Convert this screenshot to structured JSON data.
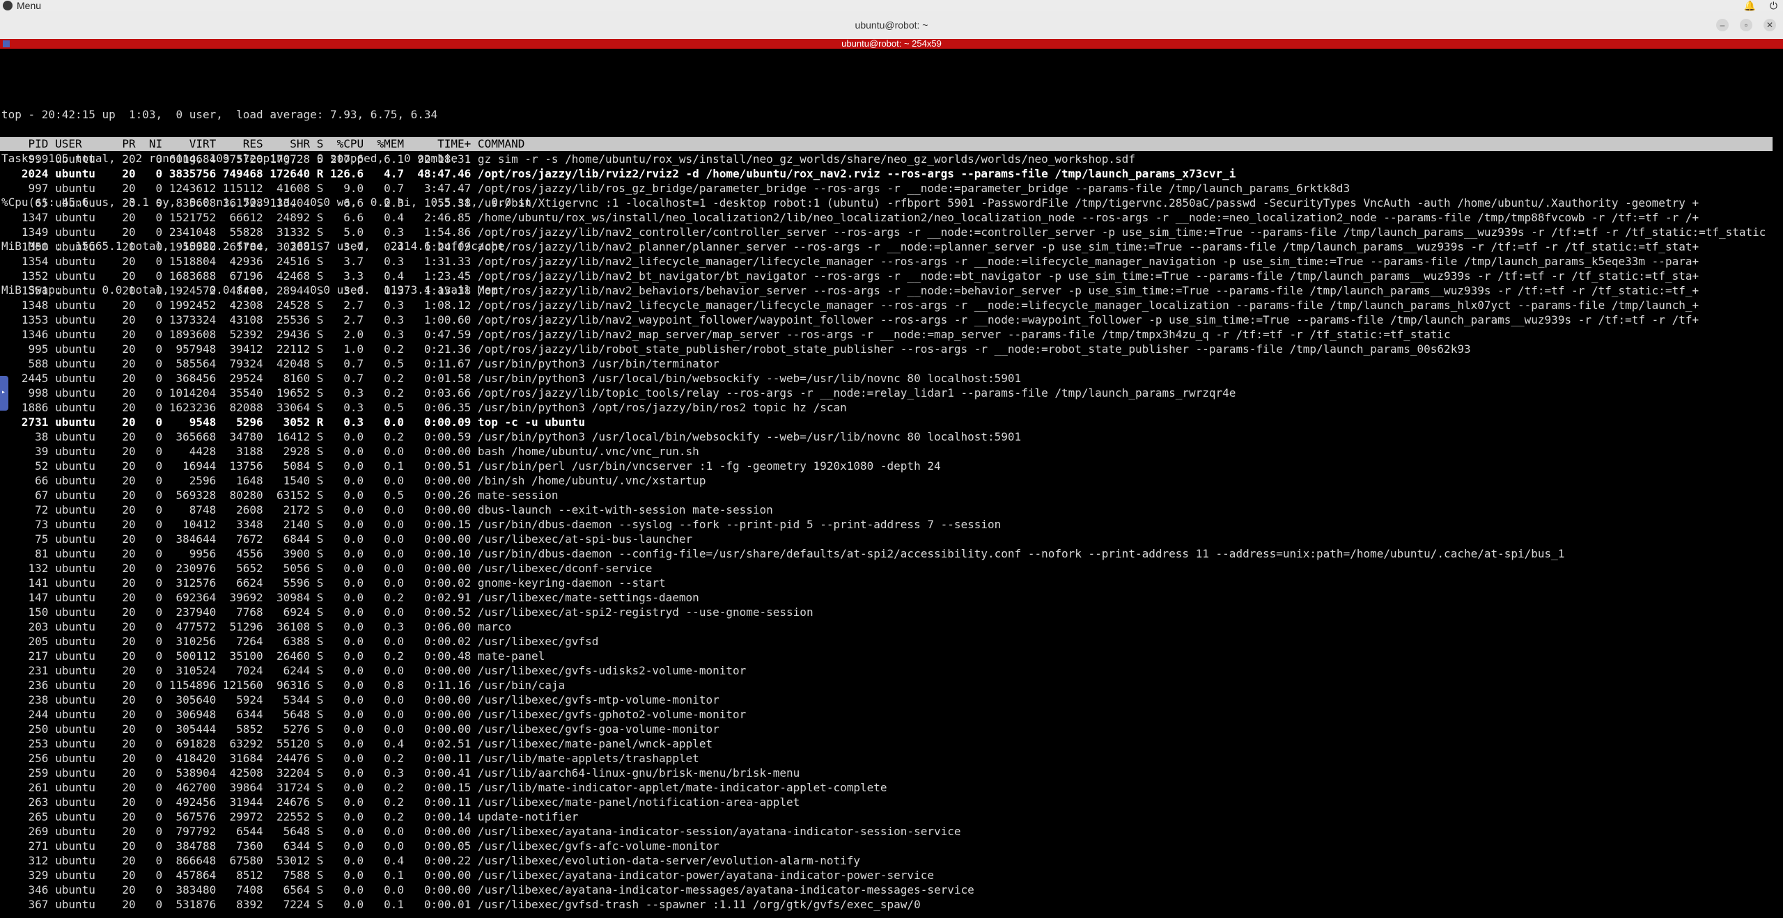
{
  "menubar": {
    "menu_label": "Menu"
  },
  "window": {
    "title": "ubuntu@robot: ~",
    "terminal_title": "ubuntu@robot: ~ 254x59"
  },
  "summary": [
    "top - 20:42:15 up  1:03,  0 user,  load average: 7.93, 6.75, 6.34",
    "Tasks: 105 total,   2 running, 103 sleeping,   0 stopped,   0 zombie",
    "%Cpu(s): 45.6 us,  3.1 sy,  0.0 ni, 50.9 id,  0.0 wa,  0.0 hi,  0.5 si,  0.0 st",
    "MiB Mem :  15665.1 total,  10022.2 free,   3691.7 used,   2314.6 buff/cache",
    "MiB Swap:      0.0 total,      0.0 free,      0.0 used.  11973.4 avail Mem"
  ],
  "header": "    PID USER      PR  NI    VIRT    RES    SHR S  %CPU  %MEM     TIME+ COMMAND",
  "processes": [
    {
      "pid": "999",
      "user": "ubuntu",
      "pr": "20",
      "ni": "0",
      "virt": "6014684",
      "res": "975720",
      "shr": "170728",
      "s": "S",
      "cpu": "207.6",
      "mem": "6.1",
      "time": "92:18.31",
      "cmd": "gz sim -r -s /home/ubuntu/rox_ws/install/neo_gz_worlds/share/neo_gz_worlds/worlds/neo_workshop.sdf"
    },
    {
      "pid": "2024",
      "user": "ubuntu",
      "pr": "20",
      "ni": "0",
      "virt": "3835756",
      "res": "749468",
      "shr": "172640",
      "s": "R",
      "cpu": "126.6",
      "mem": "4.7",
      "time": "48:47.46",
      "cmd": "/opt/ros/jazzy/lib/rviz2/rviz2 -d /home/ubuntu/rox_nav2.rviz --ros-args --params-file /tmp/launch_params_x73cvr_i",
      "bold": true
    },
    {
      "pid": "997",
      "user": "ubuntu",
      "pr": "20",
      "ni": "0",
      "virt": "1243612",
      "res": "115112",
      "shr": "41608",
      "s": "S",
      "cpu": "9.0",
      "mem": "0.7",
      "time": "3:47.47",
      "cmd": "/opt/ros/jazzy/lib/ros_gz_bridge/parameter_bridge --ros-args -r __node:=parameter_bridge --params-file /tmp/launch_params_6rktk8d3"
    },
    {
      "pid": "65",
      "user": "ubuntu",
      "pr": "20",
      "ni": "0",
      "virt": "835608",
      "res": "361728",
      "shr": "133404",
      "s": "S",
      "cpu": "6.6",
      "mem": "2.3",
      "time": "1:55.38",
      "cmd": "/usr/bin/Xtigervnc :1 -localhost=1 -desktop robot:1 (ubuntu) -rfbport 5901 -PasswordFile /tmp/tigervnc.2850aC/passwd -SecurityTypes VncAuth -auth /home/ubuntu/.Xauthority -geometry +"
    },
    {
      "pid": "1347",
      "user": "ubuntu",
      "pr": "20",
      "ni": "0",
      "virt": "1521752",
      "res": "66612",
      "shr": "24892",
      "s": "S",
      "cpu": "6.6",
      "mem": "0.4",
      "time": "2:46.85",
      "cmd": "/home/ubuntu/rox_ws/install/neo_localization2/lib/neo_localization2/neo_localization_node --ros-args -r __node:=neo_localization2_node --params-file /tmp/tmp88fvcowb -r /tf:=tf -r /+"
    },
    {
      "pid": "1349",
      "user": "ubuntu",
      "pr": "20",
      "ni": "0",
      "virt": "2341048",
      "res": "55828",
      "shr": "31332",
      "s": "S",
      "cpu": "5.0",
      "mem": "0.3",
      "time": "1:54.86",
      "cmd": "/opt/ros/jazzy/lib/nav2_controller/controller_server --ros-args -r __node:=controller_server -p use_sim_time:=True --params-file /tmp/launch_params__wuz939s -r /tf:=tf -r /tf_static:=tf_static"
    },
    {
      "pid": "1350",
      "user": "ubuntu",
      "pr": "20",
      "ni": "0",
      "virt": "1955380",
      "res": "65784",
      "shr": "30288",
      "s": "S",
      "cpu": "3.7",
      "mem": "0.4",
      "time": "1:24.09",
      "cmd": "/opt/ros/jazzy/lib/nav2_planner/planner_server --ros-args -r __node:=planner_server -p use_sim_time:=True --params-file /tmp/launch_params__wuz939s -r /tf:=tf -r /tf_static:=tf_stat+"
    },
    {
      "pid": "1354",
      "user": "ubuntu",
      "pr": "20",
      "ni": "0",
      "virt": "1518804",
      "res": "42936",
      "shr": "24516",
      "s": "S",
      "cpu": "3.7",
      "mem": "0.3",
      "time": "1:31.33",
      "cmd": "/opt/ros/jazzy/lib/nav2_lifecycle_manager/lifecycle_manager --ros-args -r __node:=lifecycle_manager_navigation -p use_sim_time:=True --params-file /tmp/launch_params_k5eqe33m --para+"
    },
    {
      "pid": "1352",
      "user": "ubuntu",
      "pr": "20",
      "ni": "0",
      "virt": "1683688",
      "res": "67196",
      "shr": "42468",
      "s": "S",
      "cpu": "3.3",
      "mem": "0.4",
      "time": "1:23.45",
      "cmd": "/opt/ros/jazzy/lib/nav2_bt_navigator/bt_navigator --ros-args -r __node:=bt_navigator -p use_sim_time:=True --params-file /tmp/launch_params__wuz939s -r /tf:=tf -r /tf_static:=tf_sta+"
    },
    {
      "pid": "1351",
      "user": "ubuntu",
      "pr": "20",
      "ni": "0",
      "virt": "1924572",
      "res": "48400",
      "shr": "28944",
      "s": "S",
      "cpu": "3.0",
      "mem": "0.3",
      "time": "1:13.38",
      "cmd": "/opt/ros/jazzy/lib/nav2_behaviors/behavior_server --ros-args -r __node:=behavior_server -p use_sim_time:=True --params-file /tmp/launch_params__wuz939s -r /tf:=tf -r /tf_static:=tf_+"
    },
    {
      "pid": "1348",
      "user": "ubuntu",
      "pr": "20",
      "ni": "0",
      "virt": "1992452",
      "res": "42308",
      "shr": "24528",
      "s": "S",
      "cpu": "2.7",
      "mem": "0.3",
      "time": "1:08.12",
      "cmd": "/opt/ros/jazzy/lib/nav2_lifecycle_manager/lifecycle_manager --ros-args -r __node:=lifecycle_manager_localization --params-file /tmp/launch_params_hlx07yct --params-file /tmp/launch_+"
    },
    {
      "pid": "1353",
      "user": "ubuntu",
      "pr": "20",
      "ni": "0",
      "virt": "1373324",
      "res": "43108",
      "shr": "25536",
      "s": "S",
      "cpu": "2.7",
      "mem": "0.3",
      "time": "1:00.60",
      "cmd": "/opt/ros/jazzy/lib/nav2_waypoint_follower/waypoint_follower --ros-args -r __node:=waypoint_follower -p use_sim_time:=True --params-file /tmp/launch_params__wuz939s -r /tf:=tf -r /tf+"
    },
    {
      "pid": "1346",
      "user": "ubuntu",
      "pr": "20",
      "ni": "0",
      "virt": "1893608",
      "res": "52392",
      "shr": "29436",
      "s": "S",
      "cpu": "2.0",
      "mem": "0.3",
      "time": "0:47.59",
      "cmd": "/opt/ros/jazzy/lib/nav2_map_server/map_server --ros-args -r __node:=map_server --params-file /tmp/tmpx3h4zu_q -r /tf:=tf -r /tf_static:=tf_static"
    },
    {
      "pid": "995",
      "user": "ubuntu",
      "pr": "20",
      "ni": "0",
      "virt": "957948",
      "res": "39412",
      "shr": "22112",
      "s": "S",
      "cpu": "1.0",
      "mem": "0.2",
      "time": "0:21.36",
      "cmd": "/opt/ros/jazzy/lib/robot_state_publisher/robot_state_publisher --ros-args -r __node:=robot_state_publisher --params-file /tmp/launch_params_00s62k93"
    },
    {
      "pid": "588",
      "user": "ubuntu",
      "pr": "20",
      "ni": "0",
      "virt": "585564",
      "res": "79324",
      "shr": "42048",
      "s": "S",
      "cpu": "0.7",
      "mem": "0.5",
      "time": "0:11.67",
      "cmd": "/usr/bin/python3 /usr/bin/terminator"
    },
    {
      "pid": "2445",
      "user": "ubuntu",
      "pr": "20",
      "ni": "0",
      "virt": "368456",
      "res": "29524",
      "shr": "8160",
      "s": "S",
      "cpu": "0.7",
      "mem": "0.2",
      "time": "0:01.58",
      "cmd": "/usr/bin/python3 /usr/local/bin/websockify --web=/usr/lib/novnc 80 localhost:5901"
    },
    {
      "pid": "998",
      "user": "ubuntu",
      "pr": "20",
      "ni": "0",
      "virt": "1014204",
      "res": "35540",
      "shr": "19652",
      "s": "S",
      "cpu": "0.3",
      "mem": "0.2",
      "time": "0:03.66",
      "cmd": "/opt/ros/jazzy/lib/topic_tools/relay --ros-args -r __node:=relay_lidar1 --params-file /tmp/launch_params_rwrzqr4e"
    },
    {
      "pid": "1886",
      "user": "ubuntu",
      "pr": "20",
      "ni": "0",
      "virt": "1623236",
      "res": "82088",
      "shr": "33064",
      "s": "S",
      "cpu": "0.3",
      "mem": "0.5",
      "time": "0:06.35",
      "cmd": "/usr/bin/python3 /opt/ros/jazzy/bin/ros2 topic hz /scan"
    },
    {
      "pid": "2731",
      "user": "ubuntu",
      "pr": "20",
      "ni": "0",
      "virt": "9548",
      "res": "5296",
      "shr": "3052",
      "s": "R",
      "cpu": "0.3",
      "mem": "0.0",
      "time": "0:00.09",
      "cmd": "top -c -u ubuntu",
      "bold": true
    },
    {
      "pid": "38",
      "user": "ubuntu",
      "pr": "20",
      "ni": "0",
      "virt": "365668",
      "res": "34780",
      "shr": "16412",
      "s": "S",
      "cpu": "0.0",
      "mem": "0.2",
      "time": "0:00.59",
      "cmd": "/usr/bin/python3 /usr/local/bin/websockify --web=/usr/lib/novnc 80 localhost:5901"
    },
    {
      "pid": "39",
      "user": "ubuntu",
      "pr": "20",
      "ni": "0",
      "virt": "4428",
      "res": "3188",
      "shr": "2928",
      "s": "S",
      "cpu": "0.0",
      "mem": "0.0",
      "time": "0:00.00",
      "cmd": "bash /home/ubuntu/.vnc/vnc_run.sh"
    },
    {
      "pid": "52",
      "user": "ubuntu",
      "pr": "20",
      "ni": "0",
      "virt": "16944",
      "res": "13756",
      "shr": "5084",
      "s": "S",
      "cpu": "0.0",
      "mem": "0.1",
      "time": "0:00.51",
      "cmd": "/usr/bin/perl /usr/bin/vncserver :1 -fg -geometry 1920x1080 -depth 24"
    },
    {
      "pid": "66",
      "user": "ubuntu",
      "pr": "20",
      "ni": "0",
      "virt": "2596",
      "res": "1648",
      "shr": "1540",
      "s": "S",
      "cpu": "0.0",
      "mem": "0.0",
      "time": "0:00.00",
      "cmd": "/bin/sh /home/ubuntu/.vnc/xstartup"
    },
    {
      "pid": "67",
      "user": "ubuntu",
      "pr": "20",
      "ni": "0",
      "virt": "569328",
      "res": "80280",
      "shr": "63152",
      "s": "S",
      "cpu": "0.0",
      "mem": "0.5",
      "time": "0:00.26",
      "cmd": "mate-session"
    },
    {
      "pid": "72",
      "user": "ubuntu",
      "pr": "20",
      "ni": "0",
      "virt": "8748",
      "res": "2608",
      "shr": "2172",
      "s": "S",
      "cpu": "0.0",
      "mem": "0.0",
      "time": "0:00.00",
      "cmd": "dbus-launch --exit-with-session mate-session"
    },
    {
      "pid": "73",
      "user": "ubuntu",
      "pr": "20",
      "ni": "0",
      "virt": "10412",
      "res": "3348",
      "shr": "2140",
      "s": "S",
      "cpu": "0.0",
      "mem": "0.0",
      "time": "0:00.15",
      "cmd": "/usr/bin/dbus-daemon --syslog --fork --print-pid 5 --print-address 7 --session"
    },
    {
      "pid": "75",
      "user": "ubuntu",
      "pr": "20",
      "ni": "0",
      "virt": "384644",
      "res": "7672",
      "shr": "6844",
      "s": "S",
      "cpu": "0.0",
      "mem": "0.0",
      "time": "0:00.00",
      "cmd": "/usr/libexec/at-spi-bus-launcher"
    },
    {
      "pid": "81",
      "user": "ubuntu",
      "pr": "20",
      "ni": "0",
      "virt": "9956",
      "res": "4556",
      "shr": "3900",
      "s": "S",
      "cpu": "0.0",
      "mem": "0.0",
      "time": "0:00.10",
      "cmd": "/usr/bin/dbus-daemon --config-file=/usr/share/defaults/at-spi2/accessibility.conf --nofork --print-address 11 --address=unix:path=/home/ubuntu/.cache/at-spi/bus_1"
    },
    {
      "pid": "132",
      "user": "ubuntu",
      "pr": "20",
      "ni": "0",
      "virt": "230976",
      "res": "5652",
      "shr": "5056",
      "s": "S",
      "cpu": "0.0",
      "mem": "0.0",
      "time": "0:00.00",
      "cmd": "/usr/libexec/dconf-service"
    },
    {
      "pid": "141",
      "user": "ubuntu",
      "pr": "20",
      "ni": "0",
      "virt": "312576",
      "res": "6624",
      "shr": "5596",
      "s": "S",
      "cpu": "0.0",
      "mem": "0.0",
      "time": "0:00.02",
      "cmd": "gnome-keyring-daemon --start"
    },
    {
      "pid": "147",
      "user": "ubuntu",
      "pr": "20",
      "ni": "0",
      "virt": "692364",
      "res": "39692",
      "shr": "30984",
      "s": "S",
      "cpu": "0.0",
      "mem": "0.2",
      "time": "0:02.91",
      "cmd": "/usr/libexec/mate-settings-daemon"
    },
    {
      "pid": "150",
      "user": "ubuntu",
      "pr": "20",
      "ni": "0",
      "virt": "237940",
      "res": "7768",
      "shr": "6924",
      "s": "S",
      "cpu": "0.0",
      "mem": "0.0",
      "time": "0:00.52",
      "cmd": "/usr/libexec/at-spi2-registryd --use-gnome-session"
    },
    {
      "pid": "203",
      "user": "ubuntu",
      "pr": "20",
      "ni": "0",
      "virt": "477572",
      "res": "51296",
      "shr": "36108",
      "s": "S",
      "cpu": "0.0",
      "mem": "0.3",
      "time": "0:06.00",
      "cmd": "marco"
    },
    {
      "pid": "205",
      "user": "ubuntu",
      "pr": "20",
      "ni": "0",
      "virt": "310256",
      "res": "7264",
      "shr": "6388",
      "s": "S",
      "cpu": "0.0",
      "mem": "0.0",
      "time": "0:00.02",
      "cmd": "/usr/libexec/gvfsd"
    },
    {
      "pid": "217",
      "user": "ubuntu",
      "pr": "20",
      "ni": "0",
      "virt": "500112",
      "res": "35100",
      "shr": "26460",
      "s": "S",
      "cpu": "0.0",
      "mem": "0.2",
      "time": "0:00.48",
      "cmd": "mate-panel"
    },
    {
      "pid": "231",
      "user": "ubuntu",
      "pr": "20",
      "ni": "0",
      "virt": "310524",
      "res": "7024",
      "shr": "6244",
      "s": "S",
      "cpu": "0.0",
      "mem": "0.0",
      "time": "0:00.00",
      "cmd": "/usr/libexec/gvfs-udisks2-volume-monitor"
    },
    {
      "pid": "236",
      "user": "ubuntu",
      "pr": "20",
      "ni": "0",
      "virt": "1154896",
      "res": "121560",
      "shr": "96316",
      "s": "S",
      "cpu": "0.0",
      "mem": "0.8",
      "time": "0:11.16",
      "cmd": "/usr/bin/caja"
    },
    {
      "pid": "238",
      "user": "ubuntu",
      "pr": "20",
      "ni": "0",
      "virt": "305640",
      "res": "5924",
      "shr": "5344",
      "s": "S",
      "cpu": "0.0",
      "mem": "0.0",
      "time": "0:00.00",
      "cmd": "/usr/libexec/gvfs-mtp-volume-monitor"
    },
    {
      "pid": "244",
      "user": "ubuntu",
      "pr": "20",
      "ni": "0",
      "virt": "306948",
      "res": "6344",
      "shr": "5648",
      "s": "S",
      "cpu": "0.0",
      "mem": "0.0",
      "time": "0:00.00",
      "cmd": "/usr/libexec/gvfs-gphoto2-volume-monitor"
    },
    {
      "pid": "250",
      "user": "ubuntu",
      "pr": "20",
      "ni": "0",
      "virt": "305444",
      "res": "5852",
      "shr": "5276",
      "s": "S",
      "cpu": "0.0",
      "mem": "0.0",
      "time": "0:00.00",
      "cmd": "/usr/libexec/gvfs-goa-volume-monitor"
    },
    {
      "pid": "253",
      "user": "ubuntu",
      "pr": "20",
      "ni": "0",
      "virt": "691828",
      "res": "63292",
      "shr": "55120",
      "s": "S",
      "cpu": "0.0",
      "mem": "0.4",
      "time": "0:02.51",
      "cmd": "/usr/libexec/mate-panel/wnck-applet"
    },
    {
      "pid": "256",
      "user": "ubuntu",
      "pr": "20",
      "ni": "0",
      "virt": "418420",
      "res": "31684",
      "shr": "24476",
      "s": "S",
      "cpu": "0.0",
      "mem": "0.2",
      "time": "0:00.11",
      "cmd": "/usr/lib/mate-applets/trashapplet"
    },
    {
      "pid": "259",
      "user": "ubuntu",
      "pr": "20",
      "ni": "0",
      "virt": "538904",
      "res": "42508",
      "shr": "32204",
      "s": "S",
      "cpu": "0.0",
      "mem": "0.3",
      "time": "0:00.41",
      "cmd": "/usr/lib/aarch64-linux-gnu/brisk-menu/brisk-menu"
    },
    {
      "pid": "261",
      "user": "ubuntu",
      "pr": "20",
      "ni": "0",
      "virt": "462700",
      "res": "39864",
      "shr": "31724",
      "s": "S",
      "cpu": "0.0",
      "mem": "0.2",
      "time": "0:00.15",
      "cmd": "/usr/lib/mate-indicator-applet/mate-indicator-applet-complete"
    },
    {
      "pid": "263",
      "user": "ubuntu",
      "pr": "20",
      "ni": "0",
      "virt": "492456",
      "res": "31944",
      "shr": "24676",
      "s": "S",
      "cpu": "0.0",
      "mem": "0.2",
      "time": "0:00.11",
      "cmd": "/usr/libexec/mate-panel/notification-area-applet"
    },
    {
      "pid": "265",
      "user": "ubuntu",
      "pr": "20",
      "ni": "0",
      "virt": "567576",
      "res": "29972",
      "shr": "22552",
      "s": "S",
      "cpu": "0.0",
      "mem": "0.2",
      "time": "0:00.14",
      "cmd": "update-notifier"
    },
    {
      "pid": "269",
      "user": "ubuntu",
      "pr": "20",
      "ni": "0",
      "virt": "797792",
      "res": "6544",
      "shr": "5648",
      "s": "S",
      "cpu": "0.0",
      "mem": "0.0",
      "time": "0:00.00",
      "cmd": "/usr/libexec/ayatana-indicator-session/ayatana-indicator-session-service"
    },
    {
      "pid": "271",
      "user": "ubuntu",
      "pr": "20",
      "ni": "0",
      "virt": "384788",
      "res": "7360",
      "shr": "6344",
      "s": "S",
      "cpu": "0.0",
      "mem": "0.0",
      "time": "0:00.05",
      "cmd": "/usr/libexec/gvfs-afc-volume-monitor"
    },
    {
      "pid": "312",
      "user": "ubuntu",
      "pr": "20",
      "ni": "0",
      "virt": "866648",
      "res": "67580",
      "shr": "53012",
      "s": "S",
      "cpu": "0.0",
      "mem": "0.4",
      "time": "0:00.22",
      "cmd": "/usr/libexec/evolution-data-server/evolution-alarm-notify"
    },
    {
      "pid": "329",
      "user": "ubuntu",
      "pr": "20",
      "ni": "0",
      "virt": "457864",
      "res": "8512",
      "shr": "7588",
      "s": "S",
      "cpu": "0.0",
      "mem": "0.1",
      "time": "0:00.00",
      "cmd": "/usr/libexec/ayatana-indicator-power/ayatana-indicator-power-service"
    },
    {
      "pid": "346",
      "user": "ubuntu",
      "pr": "20",
      "ni": "0",
      "virt": "383480",
      "res": "7408",
      "shr": "6564",
      "s": "S",
      "cpu": "0.0",
      "mem": "0.0",
      "time": "0:00.00",
      "cmd": "/usr/libexec/ayatana-indicator-messages/ayatana-indicator-messages-service"
    },
    {
      "pid": "367",
      "user": "ubuntu",
      "pr": "20",
      "ni": "0",
      "virt": "531876",
      "res": "8392",
      "shr": "7224",
      "s": "S",
      "cpu": "0.0",
      "mem": "0.1",
      "time": "0:00.01",
      "cmd": "/usr/libexec/gvfsd-trash --spawner :1.11 /org/gtk/gvfs/exec_spaw/0"
    }
  ]
}
